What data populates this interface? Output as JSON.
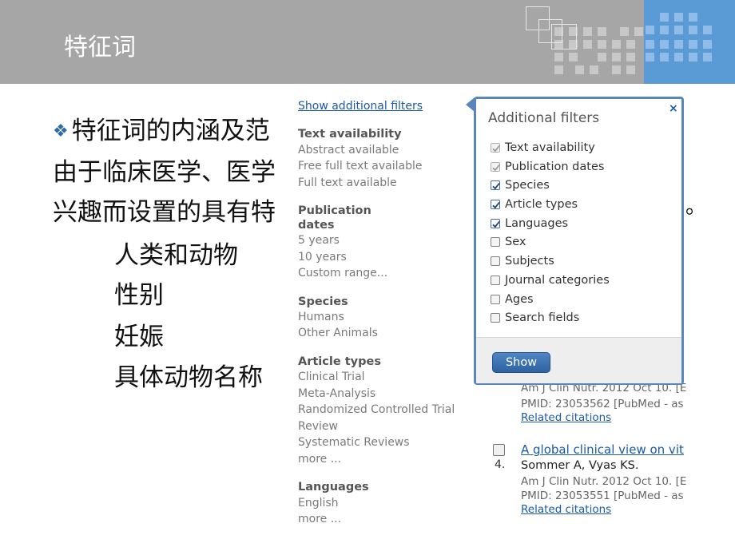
{
  "slide": {
    "title": "特征词",
    "bullet_mark": "❖",
    "lines": [
      "特征词的内涵及范",
      "由于临床医学、医学",
      "兴趣而设置的具有特"
    ],
    "trailing_char": "。",
    "sub_items": [
      "人类和动物",
      "性别",
      "妊娠",
      "具体动物名称"
    ]
  },
  "sidebar": {
    "show_filters_link": "Show additional filters",
    "groups": [
      {
        "heading": "Text availability",
        "items": [
          "Abstract available",
          "Free full text available",
          "Full text available"
        ]
      },
      {
        "heading": "Publication dates",
        "items": [
          "5 years",
          "10 years",
          "Custom range..."
        ]
      },
      {
        "heading": "Species",
        "items": [
          "Humans",
          "Other Animals"
        ]
      },
      {
        "heading": "Article types",
        "items": [
          "Clinical Trial",
          "Meta-Analysis",
          "Randomized Controlled Trial",
          "Review",
          "Systematic Reviews",
          "more ..."
        ]
      },
      {
        "heading": "Languages",
        "items": [
          "English",
          "more ..."
        ]
      }
    ]
  },
  "popup": {
    "title": "Additional filters",
    "close_label": "×",
    "options": [
      {
        "label": "Text availability",
        "state": "checked-disabled"
      },
      {
        "label": "Publication dates",
        "state": "checked-disabled"
      },
      {
        "label": "Species",
        "state": "checked"
      },
      {
        "label": "Article types",
        "state": "checked"
      },
      {
        "label": "Languages",
        "state": "checked"
      },
      {
        "label": "Sex",
        "state": "unchecked"
      },
      {
        "label": "Subjects",
        "state": "unchecked"
      },
      {
        "label": "Journal categories",
        "state": "unchecked"
      },
      {
        "label": "Ages",
        "state": "unchecked"
      },
      {
        "label": "Search fields",
        "state": "unchecked"
      }
    ],
    "show_button": "Show"
  },
  "results": {
    "partial": {
      "journal": "Am J Clin Nutr. 2012 Oct 10. [E",
      "pmid": "PMID: 23053562 [PubMed - as",
      "related": "Related citations"
    },
    "item4": {
      "number": "4.",
      "title": "A global clinical view on vit",
      "authors": "Sommer A, Vyas KS.",
      "journal": "Am J Clin Nutr. 2012 Oct 10. [E",
      "pmid": "PMID: 23053551 [PubMed - as",
      "related": "Related citations"
    }
  },
  "colors": {
    "header_gray": "#a6a6a6",
    "header_blue": "#5b9bd5",
    "link_blue": "#1a5aa6",
    "popup_border": "#5a86bb",
    "bullet": "#2f6aa8"
  },
  "icons": {
    "bullet": "diamond-cluster-icon",
    "close": "close-icon",
    "checkbox": "checkbox-icon",
    "decor": "square-pattern-icon"
  }
}
